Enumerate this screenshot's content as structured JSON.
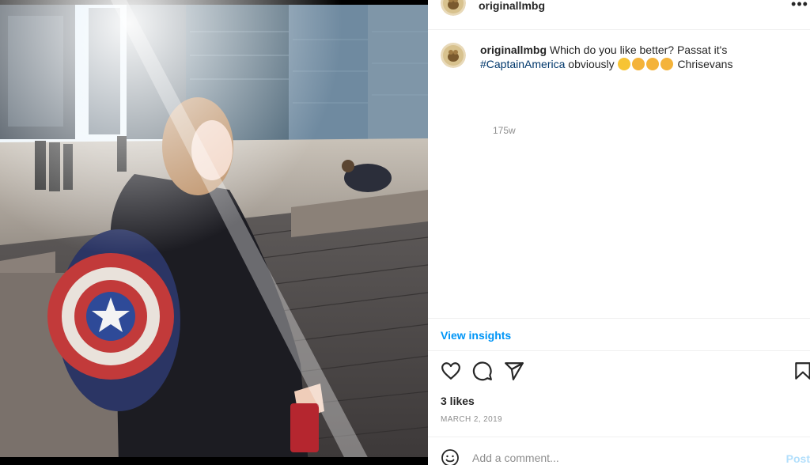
{
  "post": {
    "username": "originallmbg",
    "caption": {
      "username": "originallmbg",
      "text_line1": "Which do you like better? Passat it's",
      "hashtag": "#CaptainAmerica",
      "text_after_hashtag": "obviously",
      "text_end": "Chrisevans",
      "emojis": [
        "rolling-eyes",
        "heart-eyes",
        "heart-eyes",
        "heart-eyes"
      ],
      "time_ago": "175w"
    },
    "insights_label": "View insights",
    "likes": "3 likes",
    "date": "MARCH 2, 2019",
    "comment": {
      "placeholder": "Add a comment...",
      "post_label": "Post"
    }
  },
  "icons": {
    "header_more": "more-horizontal-icon",
    "like": "heart-icon",
    "comment": "comment-icon",
    "share": "share-icon",
    "save": "bookmark-icon",
    "emoji": "smiley-icon"
  },
  "colors": {
    "link_blue": "#0095f6",
    "hashtag_blue": "#00376b",
    "muted": "#8e8e8e",
    "post_disabled": "#b2dffc",
    "divider": "#efefef"
  }
}
